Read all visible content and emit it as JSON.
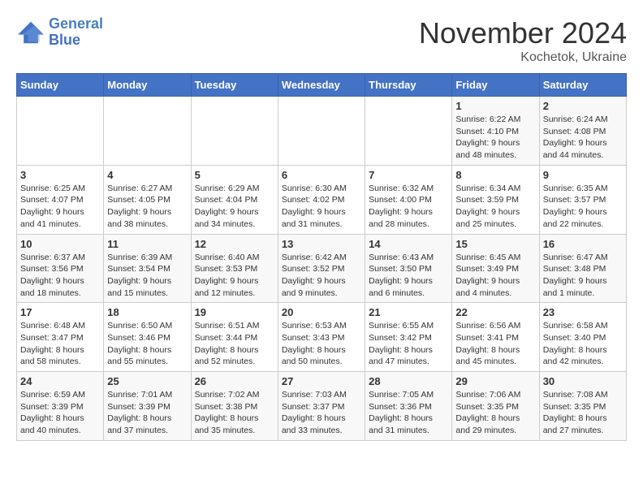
{
  "logo": {
    "line1": "General",
    "line2": "Blue"
  },
  "title": "November 2024",
  "subtitle": "Kochetok, Ukraine",
  "days_of_week": [
    "Sunday",
    "Monday",
    "Tuesday",
    "Wednesday",
    "Thursday",
    "Friday",
    "Saturday"
  ],
  "weeks": [
    [
      {
        "day": "",
        "info": ""
      },
      {
        "day": "",
        "info": ""
      },
      {
        "day": "",
        "info": ""
      },
      {
        "day": "",
        "info": ""
      },
      {
        "day": "",
        "info": ""
      },
      {
        "day": "1",
        "info": "Sunrise: 6:22 AM\nSunset: 4:10 PM\nDaylight: 9 hours and 48 minutes."
      },
      {
        "day": "2",
        "info": "Sunrise: 6:24 AM\nSunset: 4:08 PM\nDaylight: 9 hours and 44 minutes."
      }
    ],
    [
      {
        "day": "3",
        "info": "Sunrise: 6:25 AM\nSunset: 4:07 PM\nDaylight: 9 hours and 41 minutes."
      },
      {
        "day": "4",
        "info": "Sunrise: 6:27 AM\nSunset: 4:05 PM\nDaylight: 9 hours and 38 minutes."
      },
      {
        "day": "5",
        "info": "Sunrise: 6:29 AM\nSunset: 4:04 PM\nDaylight: 9 hours and 34 minutes."
      },
      {
        "day": "6",
        "info": "Sunrise: 6:30 AM\nSunset: 4:02 PM\nDaylight: 9 hours and 31 minutes."
      },
      {
        "day": "7",
        "info": "Sunrise: 6:32 AM\nSunset: 4:00 PM\nDaylight: 9 hours and 28 minutes."
      },
      {
        "day": "8",
        "info": "Sunrise: 6:34 AM\nSunset: 3:59 PM\nDaylight: 9 hours and 25 minutes."
      },
      {
        "day": "9",
        "info": "Sunrise: 6:35 AM\nSunset: 3:57 PM\nDaylight: 9 hours and 22 minutes."
      }
    ],
    [
      {
        "day": "10",
        "info": "Sunrise: 6:37 AM\nSunset: 3:56 PM\nDaylight: 9 hours and 18 minutes."
      },
      {
        "day": "11",
        "info": "Sunrise: 6:39 AM\nSunset: 3:54 PM\nDaylight: 9 hours and 15 minutes."
      },
      {
        "day": "12",
        "info": "Sunrise: 6:40 AM\nSunset: 3:53 PM\nDaylight: 9 hours and 12 minutes."
      },
      {
        "day": "13",
        "info": "Sunrise: 6:42 AM\nSunset: 3:52 PM\nDaylight: 9 hours and 9 minutes."
      },
      {
        "day": "14",
        "info": "Sunrise: 6:43 AM\nSunset: 3:50 PM\nDaylight: 9 hours and 6 minutes."
      },
      {
        "day": "15",
        "info": "Sunrise: 6:45 AM\nSunset: 3:49 PM\nDaylight: 9 hours and 4 minutes."
      },
      {
        "day": "16",
        "info": "Sunrise: 6:47 AM\nSunset: 3:48 PM\nDaylight: 9 hours and 1 minute."
      }
    ],
    [
      {
        "day": "17",
        "info": "Sunrise: 6:48 AM\nSunset: 3:47 PM\nDaylight: 8 hours and 58 minutes."
      },
      {
        "day": "18",
        "info": "Sunrise: 6:50 AM\nSunset: 3:46 PM\nDaylight: 8 hours and 55 minutes."
      },
      {
        "day": "19",
        "info": "Sunrise: 6:51 AM\nSunset: 3:44 PM\nDaylight: 8 hours and 52 minutes."
      },
      {
        "day": "20",
        "info": "Sunrise: 6:53 AM\nSunset: 3:43 PM\nDaylight: 8 hours and 50 minutes."
      },
      {
        "day": "21",
        "info": "Sunrise: 6:55 AM\nSunset: 3:42 PM\nDaylight: 8 hours and 47 minutes."
      },
      {
        "day": "22",
        "info": "Sunrise: 6:56 AM\nSunset: 3:41 PM\nDaylight: 8 hours and 45 minutes."
      },
      {
        "day": "23",
        "info": "Sunrise: 6:58 AM\nSunset: 3:40 PM\nDaylight: 8 hours and 42 minutes."
      }
    ],
    [
      {
        "day": "24",
        "info": "Sunrise: 6:59 AM\nSunset: 3:39 PM\nDaylight: 8 hours and 40 minutes."
      },
      {
        "day": "25",
        "info": "Sunrise: 7:01 AM\nSunset: 3:39 PM\nDaylight: 8 hours and 37 minutes."
      },
      {
        "day": "26",
        "info": "Sunrise: 7:02 AM\nSunset: 3:38 PM\nDaylight: 8 hours and 35 minutes."
      },
      {
        "day": "27",
        "info": "Sunrise: 7:03 AM\nSunset: 3:37 PM\nDaylight: 8 hours and 33 minutes."
      },
      {
        "day": "28",
        "info": "Sunrise: 7:05 AM\nSunset: 3:36 PM\nDaylight: 8 hours and 31 minutes."
      },
      {
        "day": "29",
        "info": "Sunrise: 7:06 AM\nSunset: 3:35 PM\nDaylight: 8 hours and 29 minutes."
      },
      {
        "day": "30",
        "info": "Sunrise: 7:08 AM\nSunset: 3:35 PM\nDaylight: 8 hours and 27 minutes."
      }
    ]
  ]
}
